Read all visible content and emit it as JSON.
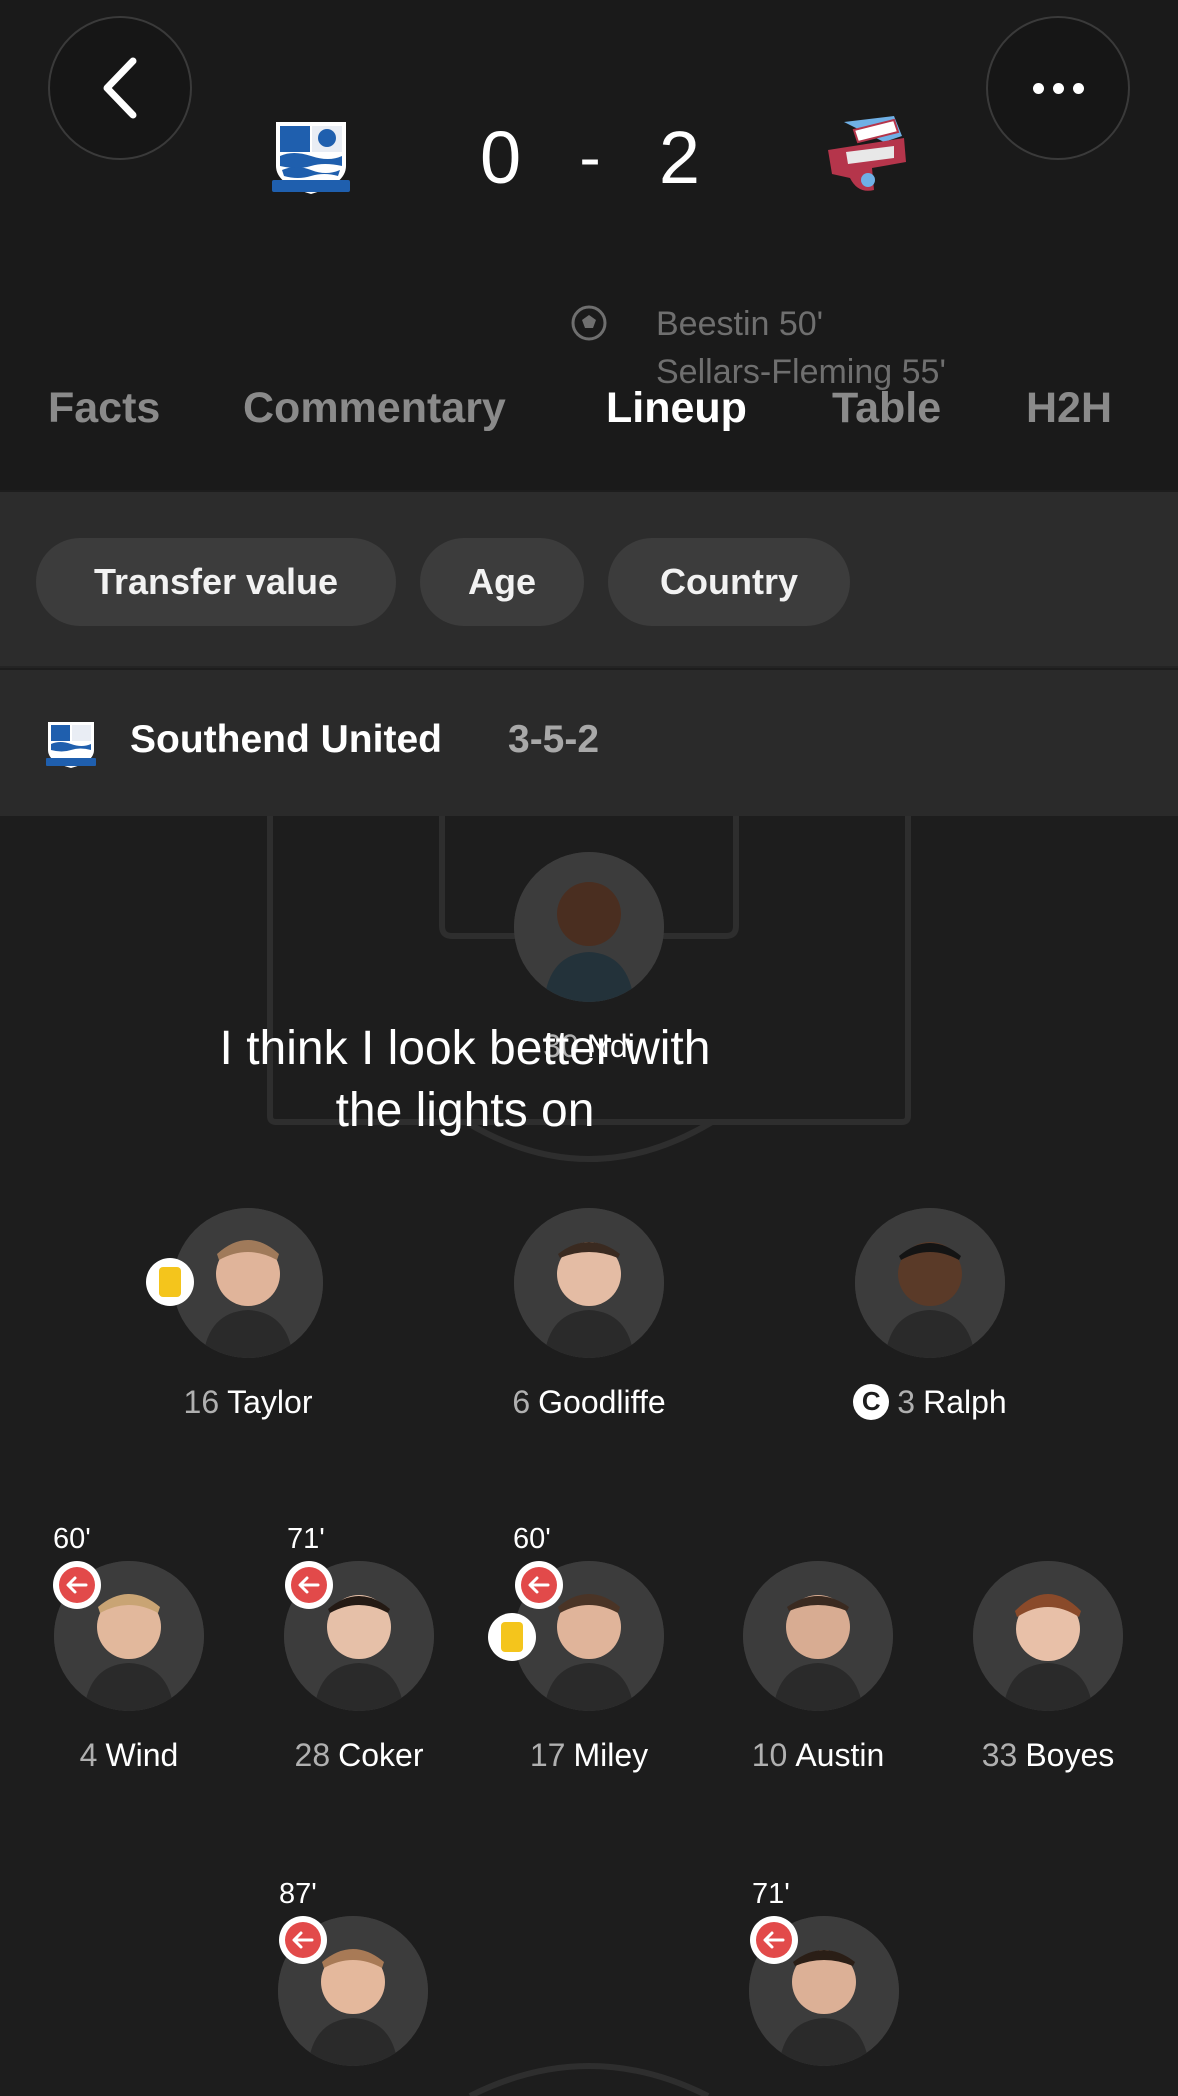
{
  "match": {
    "home_score": "0",
    "separator": "-",
    "away_score": "2",
    "scorers": [
      "Beestin 50'",
      "Sellars-Fleming 55'"
    ]
  },
  "tabs": [
    {
      "label": "Facts",
      "active": false
    },
    {
      "label": "Commentary",
      "active": false
    },
    {
      "label": "Lineup",
      "active": true
    },
    {
      "label": "Table",
      "active": false
    },
    {
      "label": "H2H",
      "active": false
    }
  ],
  "filters": [
    "Transfer value",
    "Age",
    "Country"
  ],
  "team": {
    "name": "Southend United",
    "formation": "3-5-2"
  },
  "caption": {
    "line1": "I think I look better with",
    "line2": "the lights on"
  },
  "players": {
    "gk": {
      "number": "30",
      "name": "Ndi"
    },
    "def1": {
      "number": "16",
      "name": "Taylor",
      "yellow": true
    },
    "def2": {
      "number": "6",
      "name": "Goodliffe"
    },
    "def3": {
      "number": "3",
      "name": "Ralph",
      "captain": "C"
    },
    "mid1": {
      "number": "4",
      "name": "Wind",
      "sub": "60'"
    },
    "mid2": {
      "number": "28",
      "name": "Coker",
      "sub": "71'"
    },
    "mid3": {
      "number": "17",
      "name": "Miley",
      "sub": "60'",
      "yellow": true
    },
    "mid4": {
      "number": "10",
      "name": "Austin"
    },
    "mid5": {
      "number": "33",
      "name": "Boyes"
    },
    "fw1": {
      "sub": "87'"
    },
    "fw2": {
      "sub": "71'"
    }
  },
  "colors": {
    "background": "#1d1d1d",
    "yellow_card": "#f4c51c",
    "sub_off": "#e24a4a"
  }
}
